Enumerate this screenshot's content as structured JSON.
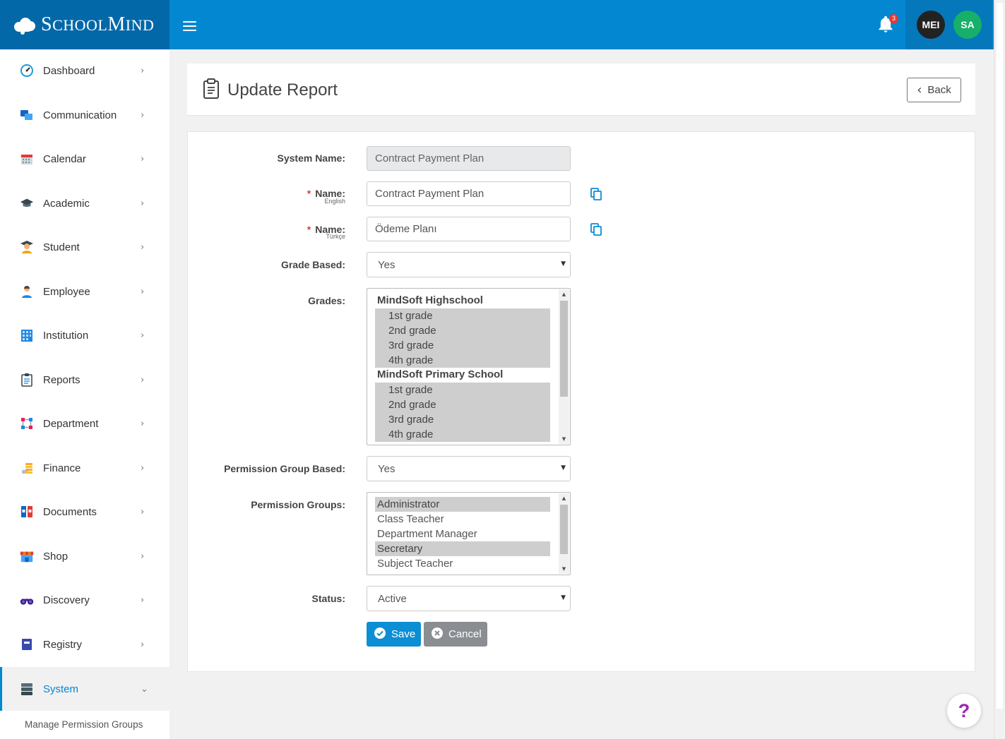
{
  "brand": {
    "name_part1": "S",
    "name_part2": "CHOOL",
    "name_part3": "M",
    "name_part4": "IND"
  },
  "topbar": {
    "notification_count": "3",
    "avatars": [
      {
        "initials": "MEI",
        "color": "#222222"
      },
      {
        "initials": "SA",
        "color": "#16b06a"
      }
    ],
    "accent_color": "#0487d1"
  },
  "sidebar": {
    "items": [
      {
        "label": "Dashboard",
        "icon": "dashboard-gauge-icon"
      },
      {
        "label": "Communication",
        "icon": "chat-bubbles-icon"
      },
      {
        "label": "Calendar",
        "icon": "calendar-icon"
      },
      {
        "label": "Academic",
        "icon": "graduation-cap-icon"
      },
      {
        "label": "Student",
        "icon": "student-icon"
      },
      {
        "label": "Employee",
        "icon": "employee-icon"
      },
      {
        "label": "Institution",
        "icon": "building-icon"
      },
      {
        "label": "Reports",
        "icon": "clipboard-icon"
      },
      {
        "label": "Department",
        "icon": "department-icon"
      },
      {
        "label": "Finance",
        "icon": "coins-icon"
      },
      {
        "label": "Documents",
        "icon": "binders-icon"
      },
      {
        "label": "Shop",
        "icon": "shop-icon"
      },
      {
        "label": "Discovery",
        "icon": "binoculars-icon"
      },
      {
        "label": "Registry",
        "icon": "book-icon"
      },
      {
        "label": "System",
        "icon": "server-icon",
        "expanded": true
      }
    ],
    "submenu": {
      "label": "Manage Permission Groups"
    }
  },
  "page": {
    "title": "Update Report",
    "back_label": "Back"
  },
  "form": {
    "system_name": {
      "label": "System Name:",
      "value": "Contract Payment Plan"
    },
    "name_en": {
      "label": "Name:",
      "sublabel": "English",
      "value": "Contract Payment Plan"
    },
    "name_tr": {
      "label": "Name:",
      "sublabel": "Türkçe",
      "value": "Ödeme Planı"
    },
    "grade_based": {
      "label": "Grade Based:",
      "value": "Yes"
    },
    "grades": {
      "label": "Grades:",
      "groups": [
        {
          "name": "MindSoft Highschool",
          "options": [
            "1st grade",
            "2nd grade",
            "3rd grade",
            "4th grade"
          ]
        },
        {
          "name": "MindSoft Primary School",
          "options": [
            "1st grade",
            "2nd grade",
            "3rd grade",
            "4th grade"
          ]
        }
      ]
    },
    "permission_group_based": {
      "label": "Permission Group Based:",
      "value": "Yes"
    },
    "permission_groups": {
      "label": "Permission Groups:",
      "options": [
        {
          "label": "Administrator",
          "selected": true
        },
        {
          "label": "Class Teacher",
          "selected": false
        },
        {
          "label": "Department Manager",
          "selected": false
        },
        {
          "label": "Secretary",
          "selected": true
        },
        {
          "label": "Subject Teacher",
          "selected": false
        }
      ]
    },
    "status": {
      "label": "Status:",
      "value": "Active"
    },
    "save_label": "Save",
    "cancel_label": "Cancel"
  },
  "help": {
    "label": "?"
  }
}
